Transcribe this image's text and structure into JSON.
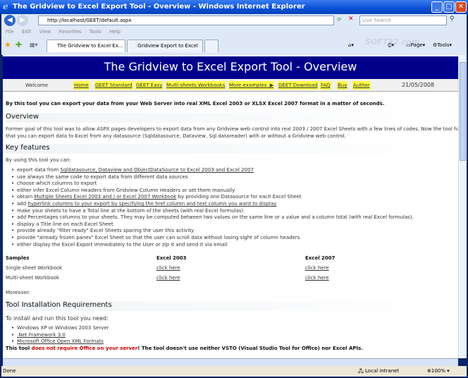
{
  "window": {
    "title": "The Gridview to Excel Export Tool - Overview - Windows Internet Explorer"
  },
  "browser": {
    "url": "http://localhost/GEET/default.aspx",
    "search_placeholder": "Live Search",
    "menu": [
      "File",
      "Edit",
      "View",
      "Favorites",
      "Tools",
      "Help"
    ],
    "tabs": [
      "The Gridview to Excel Ex...",
      "Gridview Export to Excel Tool..."
    ],
    "tools": {
      "page": "Page",
      "tools": "Tools"
    },
    "watermark": "SOFT32.com"
  },
  "page": {
    "banner": "The Gridview to Excel Export Tool - Overview",
    "welcome": "Welcome",
    "date": "21/05/2008",
    "nav": [
      "Home",
      "GEET Standard",
      "GEET Easy",
      "Multi-sheets Workbooks",
      "More examples",
      "GEET Download",
      "FAQ",
      "Buy",
      "Author"
    ],
    "intro": "By this tool you can export your data from your Web Server into real XML Excel 2003 or XLSX Excel 2007 format in a matter of seconds.",
    "overview_heading": "Overview",
    "overview_p1": "Former goal of this tool was to allow ASPX pages developers to export data from any Gridview web control into real 2003 / 2007 Excel Sheets with a few lines of codes. Now the tool has evolved so",
    "overview_p2": "that you can export data to Excel from any datasource (Sqldatasource, Dataview, Sql datareader) with or without a Gridview web control.",
    "features_heading": "Key features",
    "features_intro": "By using this tool you can:",
    "features": [
      {
        "pre": "export data from ",
        "link": "Sqldatasource, Dataview and ObjectDataSource to Excel 2003 and Excel 2007",
        "post": ""
      },
      {
        "pre": "use always the same code to export data from different data sources",
        "link": "",
        "post": ""
      },
      {
        "pre": "choose which columns to export",
        "link": "",
        "post": ""
      },
      {
        "pre": "either infer Excel Column Headers from Gridview Column Headers or set them manually",
        "link": "",
        "post": ""
      },
      {
        "pre": "obtain ",
        "link": "Multiple Sheets Excel 2003 and / or Excel 2007 Workbook",
        "post": " by providing one Datasource for each Excel Sheet"
      },
      {
        "pre": "add ",
        "link": "hyperlink columns to your export by specifying the href column and text column you want to display",
        "post": ""
      },
      {
        "pre": "make your sheets to have a Total line at the bottom of the sheets (with real Excel formulas)",
        "link": "",
        "post": ""
      },
      {
        "pre": "add Percentages columns to your sheets. They may be computed between two values on the same line or a value and a column total (with real Excel formulas).",
        "link": "",
        "post": ""
      },
      {
        "pre": "display a Title line on each Excel Sheet",
        "link": "",
        "post": ""
      },
      {
        "pre": "provide already \"filter ready\" Excel Sheets sparing the user this activity",
        "link": "",
        "post": ""
      },
      {
        "pre": "provide \"already frozen panes\" Excel Sheet so that the user can scroll data without losing sight of column headers",
        "link": "",
        "post": ""
      },
      {
        "pre": "either display the Excel Export immediately to the User or zip it and send it via email",
        "link": "",
        "post": ""
      }
    ],
    "samples": {
      "headers": [
        "Samples",
        "Excel 2003",
        "Excel 2007"
      ],
      "rows": [
        [
          "Single sheet Workbook",
          "click here",
          "click here"
        ],
        [
          "Multi-sheet Workbook",
          "click here",
          "click here"
        ]
      ]
    },
    "moreover": "Moreover:",
    "install_heading": "Tool Installation Requirements",
    "install_intro": "To install and run this tool you need:",
    "requirements": [
      "Windows XP or Windows 2003 Server",
      ".Net Framework 3.0",
      "Microsoft Office Open XML Formats"
    ],
    "note": {
      "pre": "This tool ",
      "red": "does not require Office on your server",
      "post": "! The tool doesn't use neither VSTO (Visual Studio Tool for Office) nor Excel APIs."
    }
  },
  "status": {
    "text": "Done",
    "zone": "Local intranet",
    "zoom": "100%"
  }
}
